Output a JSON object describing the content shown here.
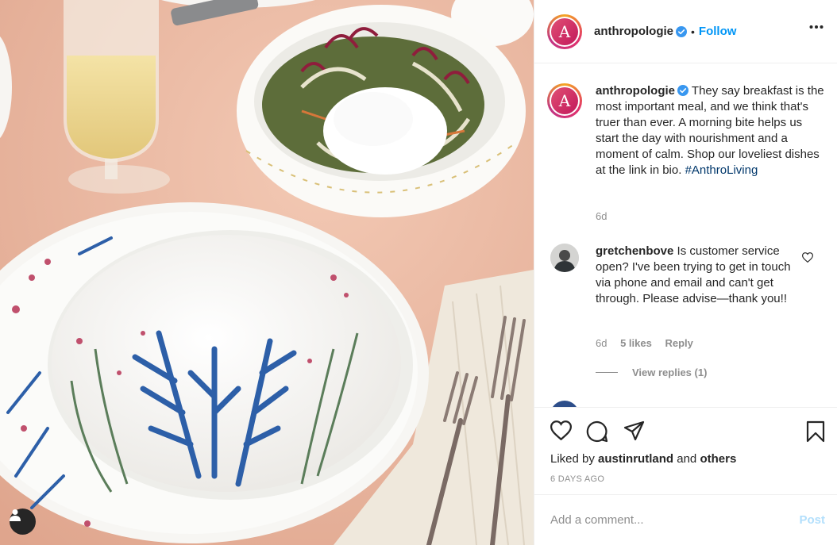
{
  "post": {
    "username": "anthropologie",
    "avatar_letter": "A",
    "separator": "•",
    "follow_label": "Follow",
    "more_icon": "more-horizontal-icon"
  },
  "caption": {
    "username": "anthropologie",
    "text": "They say breakfast is the most important meal, and we think that's truer than ever. A morning bite helps us start the day with nourishment and a moment of calm. Shop our loveliest dishes at the link in bio.",
    "hashtag": "#AnthroLiving",
    "time": "6d"
  },
  "comments": [
    {
      "username": "gretchenbove",
      "text": "Is customer service open? I've been trying to get in touch via phone and email and can't get through. Please advise—thank you!!",
      "time": "6d",
      "likes": "5 likes",
      "reply_label": "Reply",
      "view_replies": "View replies (1)"
    }
  ],
  "actions": {
    "liked_by_prefix": "Liked by",
    "liked_by_user": "austinrutland",
    "liked_by_and": "and",
    "liked_by_others": "others",
    "timestamp": "6 DAYS AGO"
  },
  "add_comment": {
    "placeholder": "Add a comment...",
    "post_label": "Post"
  },
  "colors": {
    "link_blue": "#0095f6",
    "hashtag_blue": "#00376b",
    "muted": "#8e8e8e",
    "post_disabled": "#b2dffc",
    "tablecloth": "#e9b8a3"
  }
}
